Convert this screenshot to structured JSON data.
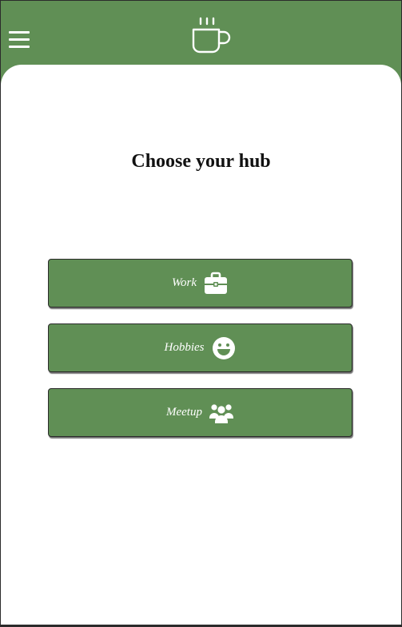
{
  "header": {
    "menu_icon": "hamburger-menu-icon",
    "logo_icon": "coffee-cup-icon"
  },
  "main": {
    "title": "Choose your hub",
    "hubs": [
      {
        "label": "Work",
        "icon": "briefcase-icon"
      },
      {
        "label": "Hobbies",
        "icon": "smiley-face-icon"
      },
      {
        "label": "Meetup",
        "icon": "group-users-icon"
      }
    ]
  },
  "colors": {
    "brand_green": "#608f55",
    "background": "#ffffff",
    "text": "#111111",
    "button_text": "#ffffff"
  }
}
